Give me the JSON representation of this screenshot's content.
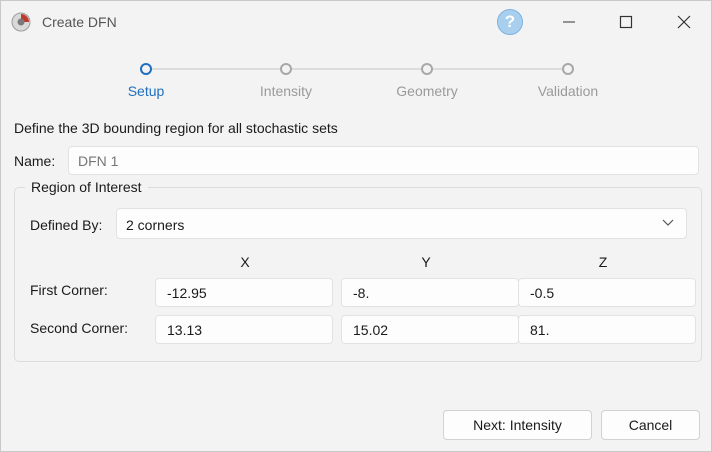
{
  "window": {
    "title": "Create DFN",
    "help_label": "?"
  },
  "steps": [
    {
      "label": "Setup",
      "active": true
    },
    {
      "label": "Intensity",
      "active": false
    },
    {
      "label": "Geometry",
      "active": false
    },
    {
      "label": "Validation",
      "active": false
    }
  ],
  "intro_text": "Define the 3D bounding region for all stochastic sets",
  "name": {
    "label": "Name:",
    "placeholder": "DFN 1"
  },
  "region": {
    "title": "Region of Interest",
    "defined_by_label": "Defined By:",
    "defined_by_value": "2 corners",
    "axes": [
      "X",
      "Y",
      "Z"
    ],
    "rows": [
      {
        "label": "First Corner:",
        "values": [
          "-12.95",
          "-8.",
          "-0.5"
        ]
      },
      {
        "label": "Second Corner:",
        "values": [
          "13.13",
          "15.02",
          "81."
        ]
      }
    ]
  },
  "buttons": {
    "next": "Next: Intensity",
    "cancel": "Cancel"
  },
  "colors": {
    "accent": "#1f6fbf",
    "help_bg": "#a9cfee"
  }
}
